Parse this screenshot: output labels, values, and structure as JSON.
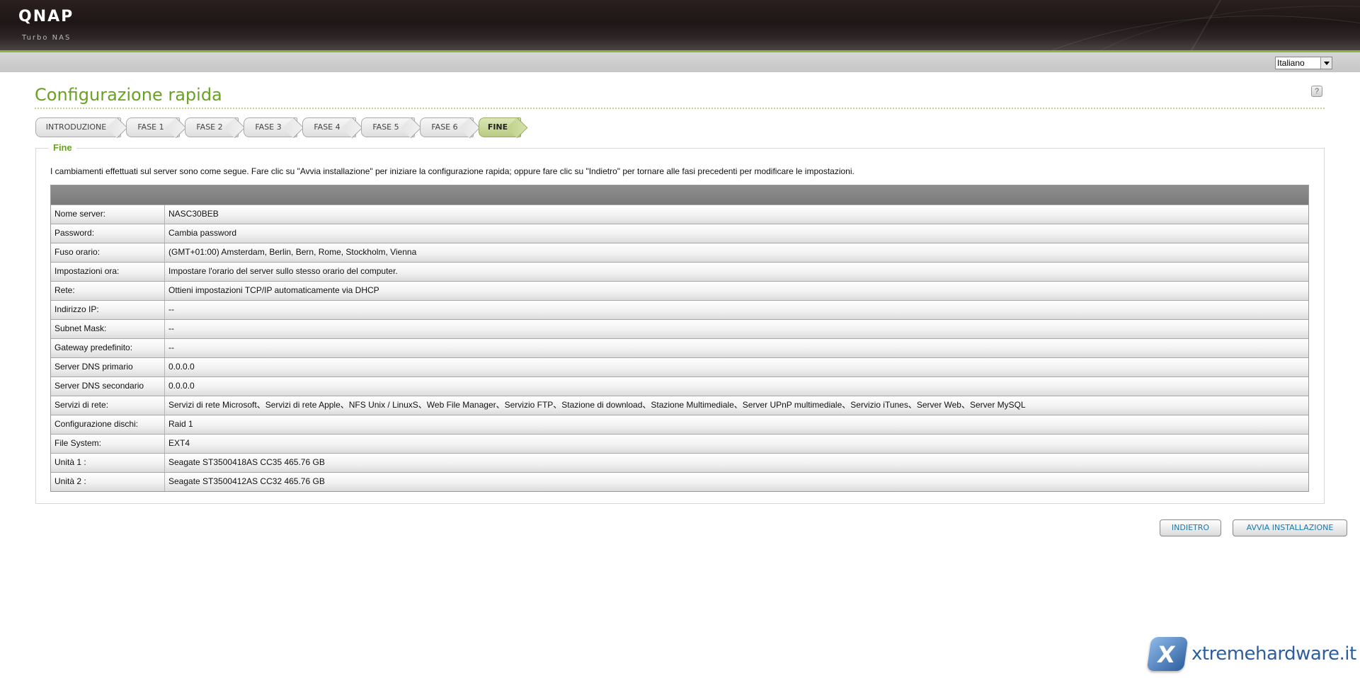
{
  "brand": {
    "name": "QNAP",
    "subtitle": "Turbo NAS"
  },
  "language": {
    "selected": "Italiano"
  },
  "page": {
    "title": "Configurazione rapida",
    "help_icon": "question-icon"
  },
  "tabs": [
    {
      "label": "INTRODUZIONE",
      "active": false
    },
    {
      "label": "FASE 1",
      "active": false
    },
    {
      "label": "FASE 2",
      "active": false
    },
    {
      "label": "FASE 3",
      "active": false
    },
    {
      "label": "FASE 4",
      "active": false
    },
    {
      "label": "FASE 5",
      "active": false
    },
    {
      "label": "FASE 6",
      "active": false
    },
    {
      "label": "FINE",
      "active": true
    }
  ],
  "section": {
    "legend": "Fine",
    "description": "I cambiamenti effettuati sul server sono come segue. Fare clic su \"Avvia installazione\" per iniziare la configurazione rapida; oppure fare clic su \"Indietro\" per tornare alle fasi precedenti per modificare le impostazioni."
  },
  "summary": {
    "rows": [
      {
        "label": "Nome server:",
        "value": "NASC30BEB"
      },
      {
        "label": "Password:",
        "value": "Cambia password"
      },
      {
        "label": "Fuso orario:",
        "value": "(GMT+01:00) Amsterdam, Berlin, Bern, Rome, Stockholm, Vienna"
      },
      {
        "label": "Impostazioni ora:",
        "value": "Impostare l'orario del server sullo stesso orario del computer."
      },
      {
        "label": "Rete:",
        "value": "Ottieni impostazioni TCP/IP automaticamente via DHCP"
      },
      {
        "label": "Indirizzo IP:",
        "value": "--"
      },
      {
        "label": "Subnet Mask:",
        "value": "--"
      },
      {
        "label": "Gateway predefinito:",
        "value": "--"
      },
      {
        "label": "Server DNS primario",
        "value": "0.0.0.0"
      },
      {
        "label": "Server DNS secondario",
        "value": "0.0.0.0"
      },
      {
        "label": "Servizi di rete:",
        "value": "Servizi di rete Microsoft、Servizi di rete Apple、NFS Unix / LinuxS、Web File Manager、Servizio FTP、Stazione di download、Stazione Multimediale、Server UPnP multimediale、Servizio iTunes、Server Web、Server MySQL"
      },
      {
        "label": "Configurazione dischi:",
        "value": "Raid 1"
      },
      {
        "label": "File System:",
        "value": "EXT4"
      },
      {
        "label": "Unità 1 :",
        "value": "Seagate ST3500418AS CC35 465.76 GB"
      },
      {
        "label": "Unità 2 :",
        "value": "Seagate ST3500412AS CC32 465.76 GB"
      }
    ]
  },
  "buttons": {
    "back": "INDIETRO",
    "start": "AVVIA INSTALLAZIONE"
  },
  "watermark": {
    "text": "xtremehardware.it"
  },
  "colors": {
    "accent_green": "#6aa125",
    "header_dark": "#1e1616",
    "button_text": "#1d7aa8"
  }
}
